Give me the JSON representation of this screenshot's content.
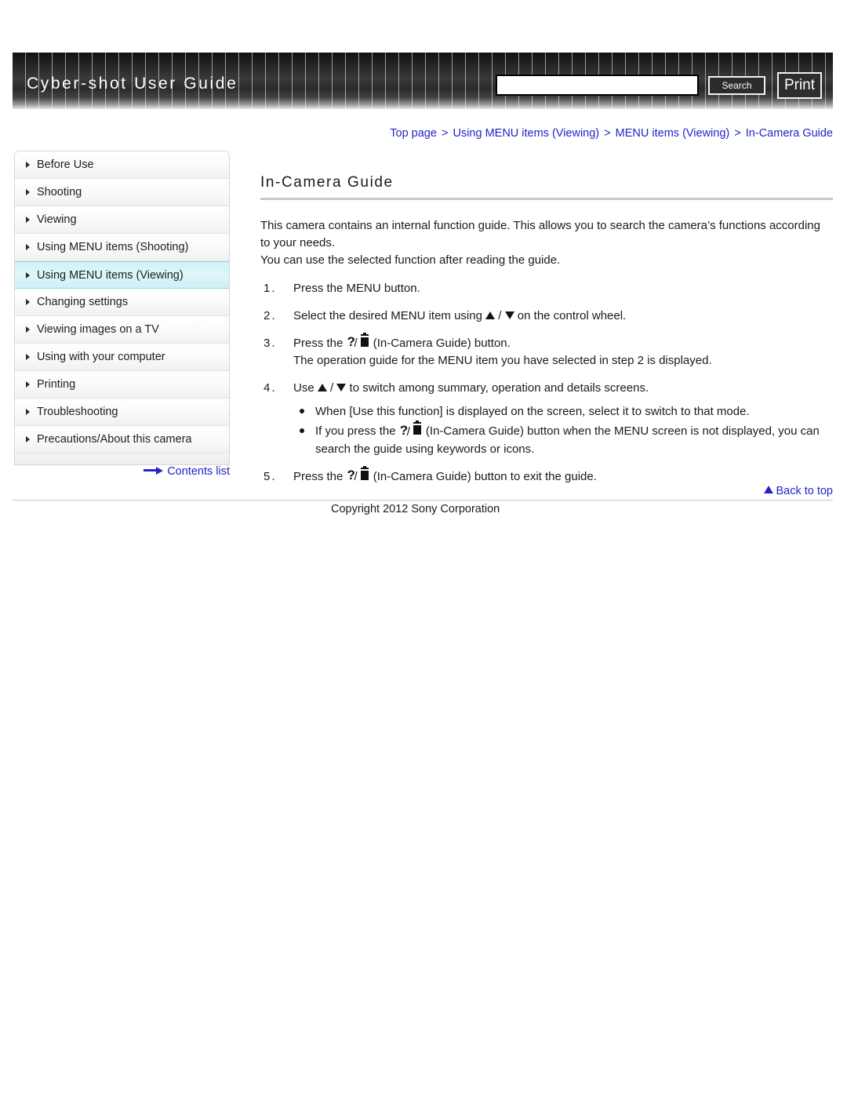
{
  "header": {
    "title": "Cyber-shot User Guide",
    "search_value": "",
    "search_placeholder": "",
    "search_label": "Search",
    "print_label": "Print"
  },
  "breadcrumb": {
    "items": [
      "Top page",
      "Using MENU items (Viewing)",
      "MENU items (Viewing)",
      "In-Camera Guide"
    ],
    "separator": ">"
  },
  "sidebar": {
    "items": [
      {
        "label": "Before Use",
        "active": false
      },
      {
        "label": "Shooting",
        "active": false
      },
      {
        "label": "Viewing",
        "active": false
      },
      {
        "label": "Using MENU items (Shooting)",
        "active": false
      },
      {
        "label": "Using MENU items (Viewing)",
        "active": true
      },
      {
        "label": "Changing settings",
        "active": false
      },
      {
        "label": "Viewing images on a TV",
        "active": false
      },
      {
        "label": "Using with your computer",
        "active": false
      },
      {
        "label": "Printing",
        "active": false
      },
      {
        "label": "Troubleshooting",
        "active": false
      },
      {
        "label": "Precautions/About this camera",
        "active": false
      }
    ],
    "contents_list_label": "Contents list"
  },
  "main": {
    "title": "In-Camera Guide",
    "intro_line1": "This camera contains an internal function guide. This allows you to search the camera’s functions according to your needs.",
    "intro_line2": "You can use the selected function after reading the guide.",
    "steps": {
      "step1_num": "1.",
      "step1_text": "Press the MENU button.",
      "step2_num": "2.",
      "step2_prefix": "Select the desired MENU item using",
      "step2_separator": "/",
      "step2_suffix": "on the control wheel.",
      "step3_num": "3.",
      "step3_prefix": "Press the",
      "step3_suffix": "(In-Camera Guide) button.",
      "step3_detail": "The operation guide for the MENU item you have selected in step 2 is displayed.",
      "step4_num": "4.",
      "step4_prefix": "Use",
      "step4_separator": "/",
      "step4_suffix": "to switch among summary, operation and details screens.",
      "step4_bullet1": "When [Use this function] is displayed on the screen, select it to switch to that mode.",
      "step4_bullet2_prefix": "If you press the",
      "step4_bullet2_suffix": "(In-Camera Guide) button when the MENU screen is not displayed, you can search the guide using keywords or icons.",
      "step5_num": "5.",
      "step5_prefix": "Press the",
      "step5_suffix": "(In-Camera Guide) button to exit the guide."
    }
  },
  "footer": {
    "back_to_top_label": "Back to top",
    "copyright": "Copyright 2012 Sony Corporation"
  },
  "icons": {
    "guide_button": "question-trash-icon",
    "up": "triangle-up-icon",
    "down": "triangle-down-icon"
  }
}
